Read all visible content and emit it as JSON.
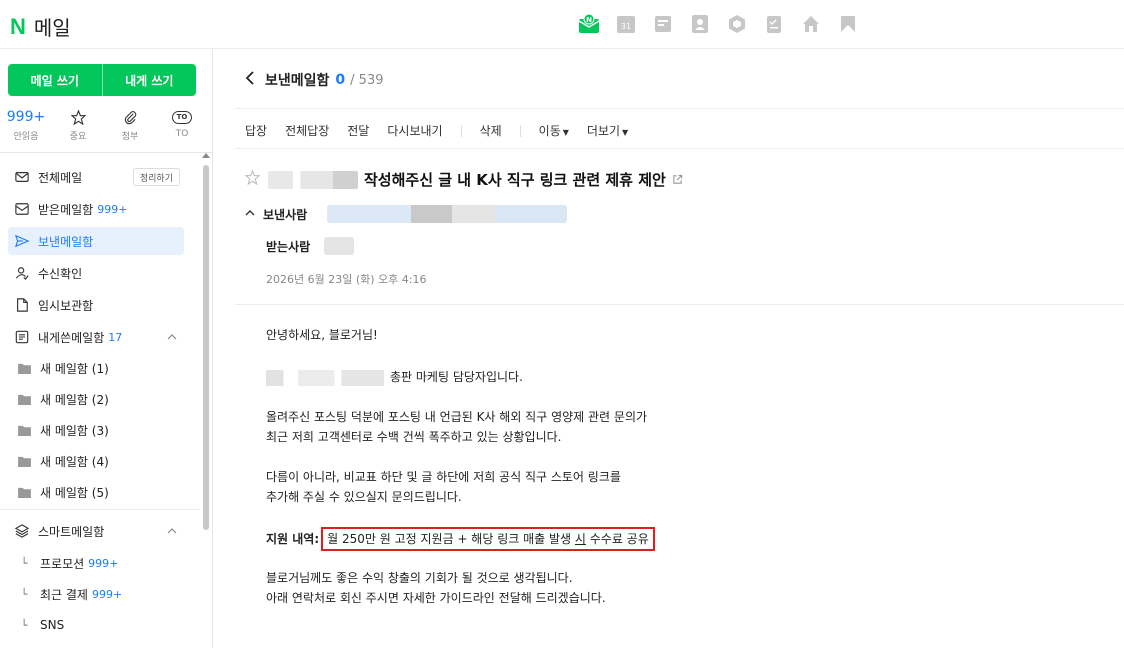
{
  "app": {
    "logo_letter": "N",
    "name": "메일"
  },
  "top_apps": [
    {
      "icon": "naver-mail-icon"
    },
    {
      "icon": "calendar-31-icon"
    },
    {
      "icon": "memo-icon"
    },
    {
      "icon": "contacts-icon"
    },
    {
      "icon": "box-icon"
    },
    {
      "icon": "todo-icon"
    },
    {
      "icon": "home-icon"
    },
    {
      "icon": "bookmark-icon"
    }
  ],
  "compose": {
    "write": "메일 쓰기",
    "write_self": "내게 쓰기"
  },
  "quick": [
    {
      "value": "999+",
      "label": "안읽음"
    },
    {
      "label": "중요"
    },
    {
      "label": "첨부"
    },
    {
      "badge": "TO",
      "label": "TO"
    }
  ],
  "nav": {
    "all": "전체메일",
    "clean": "정리하기",
    "inbox": "받은메일함",
    "inbox_count": "999+",
    "sent": "보낸메일함",
    "receipt": "수신확인",
    "drafts": "임시보관함",
    "self": "내게쓴메일함",
    "self_count": "17",
    "folders": [
      "새 메일함 (1)",
      "새 메일함 (2)",
      "새 메일함 (3)",
      "새 메일함 (4)",
      "새 메일함 (5)"
    ],
    "smart": "스마트메일함",
    "promo": "프로모션",
    "promo_count": "999+",
    "payment": "최근 결제",
    "payment_count": "999+",
    "sns": "SNS"
  },
  "header": {
    "folder": "보낸메일함",
    "count": "0",
    "total": "/ 539"
  },
  "toolbar": [
    "답장",
    "전체답장",
    "전달",
    "다시보내기",
    "삭제",
    "이동",
    "더보기"
  ],
  "mail": {
    "subject": "작성해주신 글 내 K사 직구 링크 관련 제휴 제안",
    "sender_label": "보낸사람",
    "receiver_label": "받는사람",
    "date": "2026년 6월 23일 (화) 오후 4:16",
    "greeting": "안녕하세요, 블로거님!",
    "intro": "총판 마케팅 담당자입니다.",
    "p1_l1": "올려주신 포스팅 덕분에 포스팅 내 언급된 K사 해외 직구 영양제 관련 문의가",
    "p1_l2": "최근 저희 고객센터로 수백 건씩 폭주하고 있는 상황입니다.",
    "p2_l1": "다름이 아니라, 비교표 하단 및 글 하단에 저희 공식 직구 스토어 링크를",
    "p2_l2": "추가해 주실 수 있으실지 문의드립니다.",
    "support_label": "지원 내역:",
    "support_a": "월 250만 원 고정 지원금 + 해당 링크 매출 발생 ",
    "support_b": "시",
    "support_c": " 수수료 공유",
    "p3_l1": "블로거님께도 좋은 수익 창출의 기회가 될 것으로 생각됩니다.",
    "p3_l2": "아래 연락처로 회신 주시면 자세한 가이드라인 전달해 드리겠습니다."
  },
  "colors": {
    "brand": "#03c75a",
    "accent": "#1a7cff",
    "highlight_border": "#e01e1e"
  }
}
